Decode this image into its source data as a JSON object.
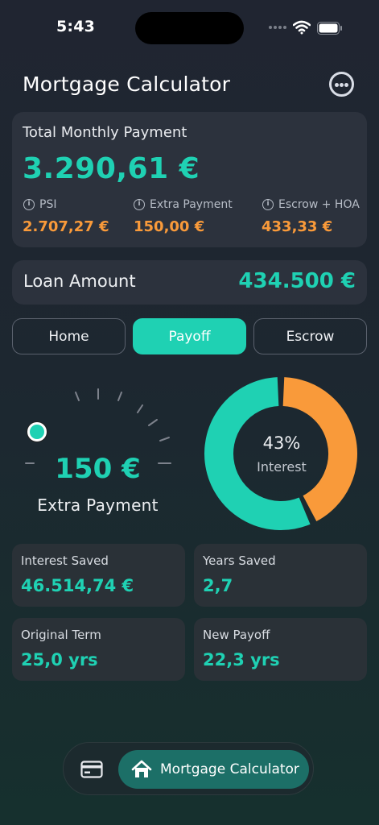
{
  "status_bar": {
    "time": "5:43"
  },
  "header": {
    "title": "Mortgage Calculator",
    "more_icon": "ellipsis-circle-icon"
  },
  "total": {
    "label": "Total Monthly Payment",
    "value": "3.290,61 €",
    "items": [
      {
        "label": "PSI",
        "value": "2.707,27 €"
      },
      {
        "label": "Extra Payment",
        "value": "150,00 €"
      },
      {
        "label": "Escrow + HOA",
        "value": "433,33 €"
      }
    ]
  },
  "loan": {
    "label": "Loan Amount",
    "value": "434.500 €"
  },
  "tabs": [
    {
      "label": "Home",
      "active": false
    },
    {
      "label": "Payoff",
      "active": true
    },
    {
      "label": "Escrow",
      "active": false
    }
  ],
  "dial": {
    "value": "150 €",
    "label": "Extra Payment"
  },
  "donut": {
    "percent_label": "43%",
    "label": "Interest",
    "interest_fraction": 0.43
  },
  "stats": [
    {
      "label": "Interest Saved",
      "value": "46.514,74 €"
    },
    {
      "label": "Years Saved",
      "value": "2,7"
    },
    {
      "label": "Original Term",
      "value": "25,0 yrs"
    },
    {
      "label": "New Payoff",
      "value": "22,3 yrs"
    }
  ],
  "bottom_nav": {
    "card_icon": "credit-card-icon",
    "home_icon": "house-icon",
    "active_label": "Mortgage Calculator"
  },
  "colors": {
    "accent": "#1fd1b3",
    "orange": "#f99a3a",
    "background": "#1d2730"
  }
}
